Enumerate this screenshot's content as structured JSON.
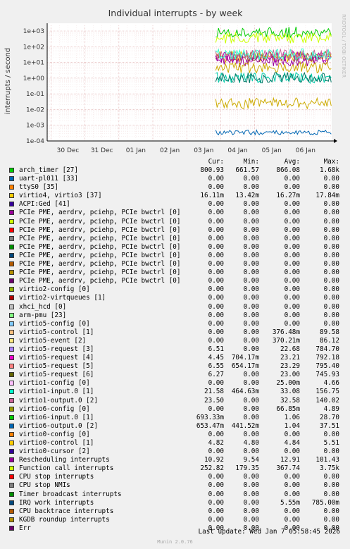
{
  "chart_data": {
    "type": "line",
    "title": "Individual interrupts - by week",
    "ylabel": "interrupts / second",
    "y_scale": "log",
    "ylim": [
      0.0001,
      1000
    ],
    "y_ticks": [
      "1e+03",
      "1e+02",
      "1e+01",
      "1e+00",
      "1e-01",
      "1e-02",
      "1e-03",
      "1e-04"
    ],
    "x_ticks": [
      "30 Dec",
      "31 Dec",
      "01 Jan",
      "02 Jan",
      "03 Jan",
      "04 Jan",
      "05 Jan",
      "06 Jan"
    ],
    "watermark": "RRDTOOL / TOBI OETIKER",
    "data_start_tick": "03 Jan",
    "series": [
      {
        "name": "arch_timer [27]",
        "color": "#00cc00",
        "level": 866.08
      },
      {
        "name": "Function call interrupts",
        "color": "#ccff00",
        "level": 367.74
      },
      {
        "name": "virtio5-request [3]",
        "color": "#e6c200",
        "level": 22.68
      },
      {
        "name": "virtio5-request [4]",
        "color": "#b900b9",
        "level": 23.21
      },
      {
        "name": "virtio5-request [5]",
        "color": "#996633",
        "level": 23.29
      },
      {
        "name": "virtio1-output.0 [2]",
        "color": "#cc6699",
        "level": 32.58
      },
      {
        "name": "Rescheduling interrupts",
        "color": "#990099",
        "level": 12.91
      },
      {
        "name": "virtio1-input.0 [1]",
        "color": "#33ffcc",
        "level": 33.08
      },
      {
        "name": "virtio0-control [1]",
        "color": "#ccaa00",
        "level": 4.84
      },
      {
        "name": "virtio6-input.0 [1]",
        "color": "#00ccaa",
        "level": 1.06
      },
      {
        "name": "virtio6-output.0 [2]",
        "color": "#007766",
        "level": 1.04
      },
      {
        "name": "uart-pl011 [33]",
        "color": "#0066b3",
        "level": 0.00035
      },
      {
        "name": "virtio1-config [0]",
        "color": "#ccaa00",
        "level": 0.025
      }
    ]
  },
  "legend_header": {
    "cur": "Cur:",
    "min": "Min:",
    "avg": "Avg:",
    "max": "Max:"
  },
  "legend": [
    {
      "name": "arch_timer [27]",
      "color": "#00cc00",
      "cur": "800.93",
      "min": "661.57",
      "avg": "866.08",
      "max": "1.68k"
    },
    {
      "name": "uart-pl011 [33]",
      "color": "#0066b3",
      "cur": "0.00",
      "min": "0.00",
      "avg": "0.00",
      "max": "0.00"
    },
    {
      "name": "ttyS0 [35]",
      "color": "#ff8000",
      "cur": "0.00",
      "min": "0.00",
      "avg": "0.00",
      "max": "0.00"
    },
    {
      "name": "virtio4, virtio3 [37]",
      "color": "#ffcc00",
      "cur": "16.11m",
      "min": "13.42m",
      "avg": "16.27m",
      "max": "17.84m"
    },
    {
      "name": "ACPI:Ged [41]",
      "color": "#330099",
      "cur": "0.00",
      "min": "0.00",
      "avg": "0.00",
      "max": "0.00"
    },
    {
      "name": "PCIe PME, aerdrv, pciehp, PCIe bwctrl [0]",
      "color": "#990099",
      "cur": "0.00",
      "min": "0.00",
      "avg": "0.00",
      "max": "0.00"
    },
    {
      "name": "PCIe PME, aerdrv, pciehp, PCIe bwctrl [0]",
      "color": "#ccff00",
      "cur": "0.00",
      "min": "0.00",
      "avg": "0.00",
      "max": "0.00"
    },
    {
      "name": "PCIe PME, aerdrv, pciehp, PCIe bwctrl [0]",
      "color": "#ff0000",
      "cur": "0.00",
      "min": "0.00",
      "avg": "0.00",
      "max": "0.00"
    },
    {
      "name": "PCIe PME, aerdrv, pciehp, PCIe bwctrl [0]",
      "color": "#808080",
      "cur": "0.00",
      "min": "0.00",
      "avg": "0.00",
      "max": "0.00"
    },
    {
      "name": "PCIe PME, aerdrv, pciehp, PCIe bwctrl [0]",
      "color": "#008f00",
      "cur": "0.00",
      "min": "0.00",
      "avg": "0.00",
      "max": "0.00"
    },
    {
      "name": "PCIe PME, aerdrv, pciehp, PCIe bwctrl [0]",
      "color": "#00487d",
      "cur": "0.00",
      "min": "0.00",
      "avg": "0.00",
      "max": "0.00"
    },
    {
      "name": "PCIe PME, aerdrv, pciehp, PCIe bwctrl [0]",
      "color": "#b35a00",
      "cur": "0.00",
      "min": "0.00",
      "avg": "0.00",
      "max": "0.00"
    },
    {
      "name": "PCIe PME, aerdrv, pciehp, PCIe bwctrl [0]",
      "color": "#b38f00",
      "cur": "0.00",
      "min": "0.00",
      "avg": "0.00",
      "max": "0.00"
    },
    {
      "name": "PCIe PME, aerdrv, pciehp, PCIe bwctrl [0]",
      "color": "#6b006b",
      "cur": "0.00",
      "min": "0.00",
      "avg": "0.00",
      "max": "0.00"
    },
    {
      "name": "virtio2-config [0]",
      "color": "#8fb300",
      "cur": "0.00",
      "min": "0.00",
      "avg": "0.00",
      "max": "0.00"
    },
    {
      "name": "virtio2-virtqueues [1]",
      "color": "#b30000",
      "cur": "0.00",
      "min": "0.00",
      "avg": "0.00",
      "max": "0.00"
    },
    {
      "name": "xhci_hcd [0]",
      "color": "#bebebe",
      "cur": "0.00",
      "min": "0.00",
      "avg": "0.00",
      "max": "0.00"
    },
    {
      "name": "arm-pmu [23]",
      "color": "#80ff80",
      "cur": "0.00",
      "min": "0.00",
      "avg": "0.00",
      "max": "0.00"
    },
    {
      "name": "virtio5-config [0]",
      "color": "#80c9ff",
      "cur": "0.00",
      "min": "0.00",
      "avg": "0.00",
      "max": "0.00"
    },
    {
      "name": "virtio5-control [1]",
      "color": "#ffc080",
      "cur": "0.00",
      "min": "0.00",
      "avg": "376.48m",
      "max": "89.58"
    },
    {
      "name": "virtio5-event [2]",
      "color": "#ffe680",
      "cur": "0.00",
      "min": "0.00",
      "avg": "370.21m",
      "max": "86.12"
    },
    {
      "name": "virtio5-request [3]",
      "color": "#aa80ff",
      "cur": "6.51",
      "min": "0.00",
      "avg": "22.68",
      "max": "784.70"
    },
    {
      "name": "virtio5-request [4]",
      "color": "#ee00cc",
      "cur": "4.45",
      "min": "704.17m",
      "avg": "23.21",
      "max": "792.18"
    },
    {
      "name": "virtio5-request [5]",
      "color": "#ff8080",
      "cur": "6.55",
      "min": "654.17m",
      "avg": "23.29",
      "max": "795.40"
    },
    {
      "name": "virtio5-request [6]",
      "color": "#666600",
      "cur": "6.27",
      "min": "0.00",
      "avg": "23.00",
      "max": "745.93"
    },
    {
      "name": "virtio1-config [0]",
      "color": "#ffbfff",
      "cur": "0.00",
      "min": "0.00",
      "avg": "25.00m",
      "max": "4.66"
    },
    {
      "name": "virtio1-input.0 [1]",
      "color": "#00ffcc",
      "cur": "21.58",
      "min": "464.63m",
      "avg": "33.08",
      "max": "156.75"
    },
    {
      "name": "virtio1-output.0 [2]",
      "color": "#cc6699",
      "cur": "23.50",
      "min": "0.00",
      "avg": "32.58",
      "max": "140.02"
    },
    {
      "name": "virtio6-config [0]",
      "color": "#999900",
      "cur": "0.00",
      "min": "0.00",
      "avg": "66.85m",
      "max": "4.89"
    },
    {
      "name": "virtio6-input.0 [1]",
      "color": "#00cc00",
      "cur": "693.33m",
      "min": "0.00",
      "avg": "1.06",
      "max": "28.70"
    },
    {
      "name": "virtio6-output.0 [2]",
      "color": "#0066b3",
      "cur": "653.47m",
      "min": "441.52m",
      "avg": "1.04",
      "max": "37.51"
    },
    {
      "name": "virtio0-config [0]",
      "color": "#ff8000",
      "cur": "0.00",
      "min": "0.00",
      "avg": "0.00",
      "max": "0.00"
    },
    {
      "name": "virtio0-control [1]",
      "color": "#ffcc00",
      "cur": "4.82",
      "min": "4.80",
      "avg": "4.84",
      "max": "5.51"
    },
    {
      "name": "virtio0-cursor [2]",
      "color": "#330099",
      "cur": "0.00",
      "min": "0.00",
      "avg": "0.00",
      "max": "0.00"
    },
    {
      "name": "Rescheduling interrupts",
      "color": "#990099",
      "cur": "10.92",
      "min": "9.54",
      "avg": "12.91",
      "max": "101.43"
    },
    {
      "name": "Function call interrupts",
      "color": "#ccff00",
      "cur": "252.82",
      "min": "179.35",
      "avg": "367.74",
      "max": "3.75k"
    },
    {
      "name": "CPU stop interrupts",
      "color": "#ff0000",
      "cur": "0.00",
      "min": "0.00",
      "avg": "0.00",
      "max": "0.00"
    },
    {
      "name": "CPU stop NMIs",
      "color": "#808080",
      "cur": "0.00",
      "min": "0.00",
      "avg": "0.00",
      "max": "0.00"
    },
    {
      "name": "Timer broadcast interrupts",
      "color": "#008f00",
      "cur": "0.00",
      "min": "0.00",
      "avg": "0.00",
      "max": "0.00"
    },
    {
      "name": "IRQ work interrupts",
      "color": "#00487d",
      "cur": "0.00",
      "min": "0.00",
      "avg": "5.55m",
      "max": "785.00m"
    },
    {
      "name": "CPU backtrace interrupts",
      "color": "#b35a00",
      "cur": "0.00",
      "min": "0.00",
      "avg": "0.00",
      "max": "0.00"
    },
    {
      "name": "KGDB roundup interrupts",
      "color": "#b38f00",
      "cur": "0.00",
      "min": "0.00",
      "avg": "0.00",
      "max": "0.00"
    },
    {
      "name": "Err",
      "color": "#6b006b",
      "cur": "0.00",
      "min": "0.00",
      "avg": "0.00",
      "max": "0.00"
    }
  ],
  "footer": {
    "last_update": "Last update: Wed Jan  7 05:58:45 2026",
    "munin": "Munin 2.0.76"
  }
}
